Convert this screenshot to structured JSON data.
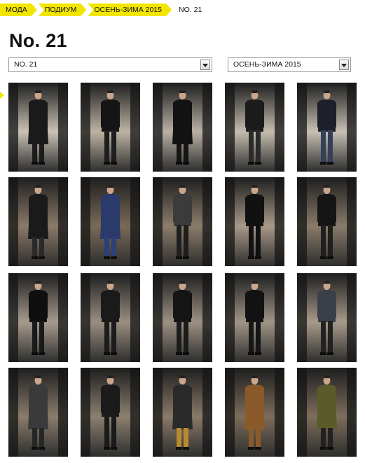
{
  "breadcrumb": {
    "items": [
      "МОДА",
      "ПОДИУМ",
      "ОСЕНЬ-ЗИМА 2015"
    ],
    "current": "NO. 21"
  },
  "page": {
    "title": "No. 21"
  },
  "selects": {
    "designer": "NO. 21",
    "season": "ОСЕНЬ-ЗИМА 2015"
  },
  "colors": {
    "accent": "#f2e600"
  },
  "looks": [
    {
      "top": "#1a1a1a",
      "bottom": "#1c1c1c",
      "light": "#c9c1b4",
      "coat": true
    },
    {
      "top": "#151515",
      "bottom": "#1e1e1e",
      "light": "#bdb3a3",
      "coat": false
    },
    {
      "top": "#121212",
      "bottom": "#151515",
      "light": "#b8b0a4",
      "coat": true
    },
    {
      "top": "#1b1b1b",
      "bottom": "#2b2b2b",
      "light": "#c4bcae",
      "coat": false
    },
    {
      "top": "#1d1f2a",
      "bottom": "#34405a",
      "light": "#c7c0b4",
      "coat": false
    },
    {
      "top": "#1a1a1a",
      "bottom": "#2a2a2a",
      "light": "#8b7a68",
      "coat": true
    },
    {
      "top": "#2a3a6b",
      "bottom": "#2b3f78",
      "light": "#7a6a58",
      "coat": true
    },
    {
      "top": "#3b3b3b",
      "bottom": "#1e1e1e",
      "light": "#8c7c6a",
      "coat": false
    },
    {
      "top": "#111111",
      "bottom": "#111111",
      "light": "#a89888",
      "coat": false
    },
    {
      "top": "#151515",
      "bottom": "#1f1f1f",
      "light": "#8a7b6a",
      "coat": false
    },
    {
      "top": "#0f0f0f",
      "bottom": "#1a1a1a",
      "light": "#a69a8c",
      "coat": false
    },
    {
      "top": "#1a1a1a",
      "bottom": "#1c1c1c",
      "light": "#9a8e80",
      "coat": false
    },
    {
      "top": "#151515",
      "bottom": "#1b1b1b",
      "light": "#9c9082",
      "coat": false
    },
    {
      "top": "#121212",
      "bottom": "#161616",
      "light": "#a09486",
      "coat": false
    },
    {
      "top": "#3a3f4a",
      "bottom": "#222222",
      "light": "#a89a8a",
      "coat": false
    },
    {
      "top": "#3a3a3a",
      "bottom": "#262626",
      "light": "#8a7c6c",
      "coat": true
    },
    {
      "top": "#1b1b1b",
      "bottom": "#1a1a1a",
      "light": "#8c8070",
      "coat": false
    },
    {
      "top": "#2a2a2a",
      "bottom": "#b8892f",
      "light": "#8a7a68",
      "coat": true
    },
    {
      "top": "#8a5a2a",
      "bottom": "#8a5a2a",
      "light": "#7c6c5a",
      "coat": true
    },
    {
      "top": "#5a5a2a",
      "bottom": "#222222",
      "light": "#7e6e5c",
      "coat": true
    }
  ]
}
